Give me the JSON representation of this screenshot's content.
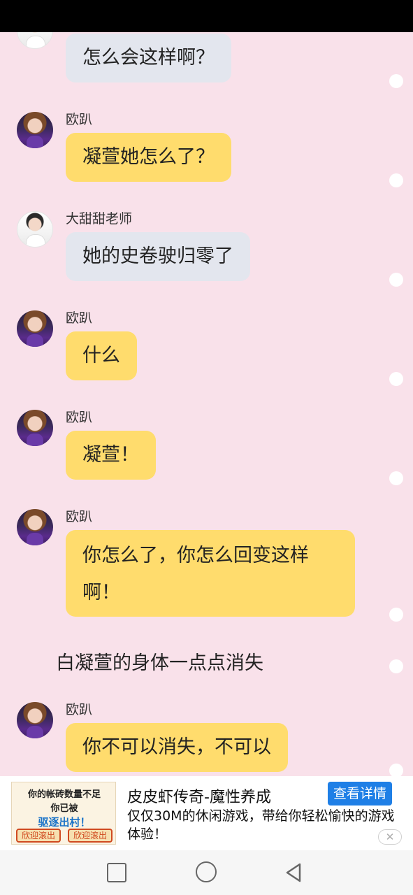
{
  "chat": {
    "messages": [
      {
        "sender": "",
        "text": "怎么会这样啊？"
      },
      {
        "sender": "欧趴",
        "text": "凝萱她怎么了？"
      },
      {
        "sender": "大甜甜老师",
        "text": "她的史卷驶归零了"
      },
      {
        "sender": "欧趴",
        "text": "什么"
      },
      {
        "sender": "欧趴",
        "text": "凝萱！"
      },
      {
        "sender": "欧趴",
        "text_line1": "你怎么了，你怎么回变这样",
        "text_line2": "啊！"
      },
      {
        "sender": "欧趴",
        "text": "你不可以消失，不可以"
      }
    ],
    "narration": "白凝萱的身体一点点消失"
  },
  "ad": {
    "image_line1": "你的帐砖数量不足",
    "image_line2": "你已被",
    "image_line3": "驱逐出村！",
    "image_btn_left": "欣迎滚出",
    "image_btn_right": "欣迎滚出",
    "title": "皮皮虾传奇-魔性养成",
    "description": "仅仅30M的休闲游戏，带给你轻松愉快的游戏体验！",
    "cta_label": "查看详情",
    "close_glyph": "✕"
  },
  "colors": {
    "background": "#f9e1ea",
    "bubble_grey": "#e3e6ee",
    "bubble_yellow": "#ffdc6d",
    "ad_button": "#1f7fe6"
  }
}
